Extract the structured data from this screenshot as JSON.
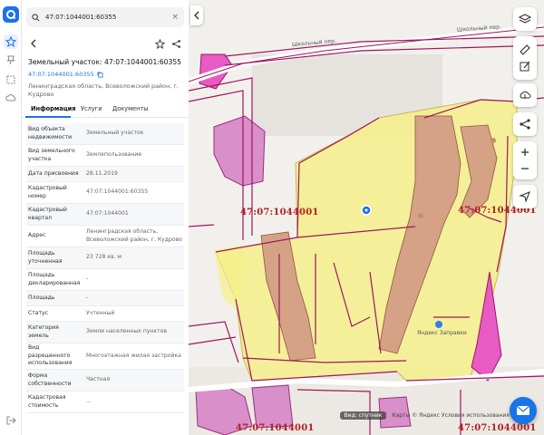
{
  "app": {
    "accent": "#1a73e8"
  },
  "rail": {
    "items": [
      {
        "icon": "logo-icon"
      },
      {
        "icon": "star-icon"
      },
      {
        "icon": "pin-icon"
      },
      {
        "icon": "square-icon"
      },
      {
        "icon": "cloud-icon"
      },
      {
        "icon": "logout-icon"
      }
    ]
  },
  "search": {
    "value": "47:07:1044001:60355",
    "clear": "×"
  },
  "panel": {
    "title": "Земельный участок: 47:07:1044001:60355",
    "cad_link": "47:07:1044001:60355",
    "address": "Ленинградская область, Всеволожский район, г. Кудрово",
    "tabs": [
      {
        "label": "Информация",
        "active": true
      },
      {
        "label": "Услуги",
        "active": false
      },
      {
        "label": "Документы",
        "active": false
      }
    ],
    "rows": [
      {
        "key": "Вид объекта недвижимости",
        "value": "Земельный участок"
      },
      {
        "key": "Вид земельного участка",
        "value": "Землепользование"
      },
      {
        "key": "Дата присвоения",
        "value": "28.11.2019"
      },
      {
        "key": "Кадастровый номер",
        "value": "47:07:1044001:60355"
      },
      {
        "key": "Кадастровый квартал",
        "value": "47:07:1044001"
      },
      {
        "key": "Адрес",
        "value": "Ленинградская область, Всеволожский район, г. Кудрово"
      },
      {
        "key": "Площадь уточненная",
        "value": "23 728 кв. м"
      },
      {
        "key": "Площадь декларированная",
        "value": "-"
      },
      {
        "key": "Площадь",
        "value": "-"
      },
      {
        "key": "Статус",
        "value": "Учтенный"
      },
      {
        "key": "Категория земель",
        "value": "Земли населенных пунктов"
      },
      {
        "key": "Вид разрешенного использования",
        "value": "Многоэтажная жилая застройка"
      },
      {
        "key": "Форма собственности",
        "value": "Частная"
      },
      {
        "key": "Кадастровая стоимость",
        "value": "..."
      }
    ]
  },
  "map": {
    "cad_labels": [
      "47:07:1044001",
      "47:07:1044001",
      "47:07:1044001",
      "47:07:1044001"
    ],
    "streets": [
      "Школьный пер.",
      "Школьный пер."
    ],
    "poi": "Яндекс Заправки",
    "satellite_label": "Вид: спутник",
    "attribution": "Карты © Яндекс   Условия использования",
    "controls": [
      "layers-icon",
      "ruler-icon",
      "edit-icon",
      "upload-icon",
      "share-icon",
      "zoom-in-icon",
      "zoom-out-icon",
      "locate-icon"
    ],
    "colors": {
      "parcel": "#f5ef8a",
      "boundary": "#a0155f",
      "building": "#d98fc9",
      "roof": "#d5a286",
      "label": "#b22020"
    }
  }
}
